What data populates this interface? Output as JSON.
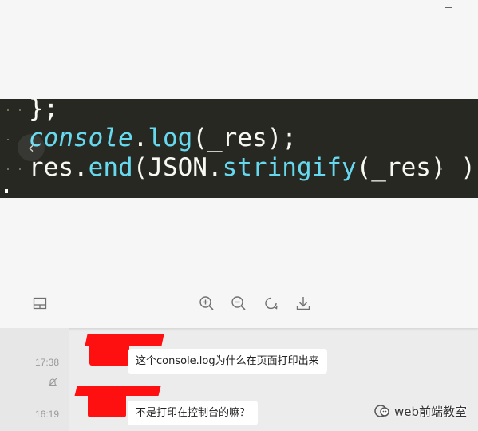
{
  "viewer": {
    "code": {
      "line1": "};",
      "line2_obj": "console",
      "line2_dot": ".",
      "line2_fn": "log",
      "line2_rest": "(_res);",
      "line3_a": "res.",
      "line3_fn1": "end",
      "line3_b": "(JSON.",
      "line3_fn2": "stringify",
      "line3_c": "(_res) )"
    },
    "icons": {
      "minimize": "minimize-icon",
      "prev": "chevron-left-icon",
      "thumbnails": "thumbnail-icon",
      "zoom_in": "zoom-in-icon",
      "zoom_out": "zoom-out-icon",
      "rotate": "rotate-icon",
      "download": "download-icon"
    },
    "prev_glyph": "‹"
  },
  "chat": {
    "messages": [
      {
        "time": "17:38",
        "text": "这个console.log为什么在页面打印出来",
        "muted": true
      },
      {
        "time": "16:19",
        "text": "不是打印在控制台的嘛？",
        "muted": false
      }
    ],
    "colors": {
      "redaction": "#ff1010",
      "bubble": "#ffffff"
    }
  },
  "watermark": {
    "text": "web前端教室",
    "logo": "wechat-official-account-logo"
  }
}
